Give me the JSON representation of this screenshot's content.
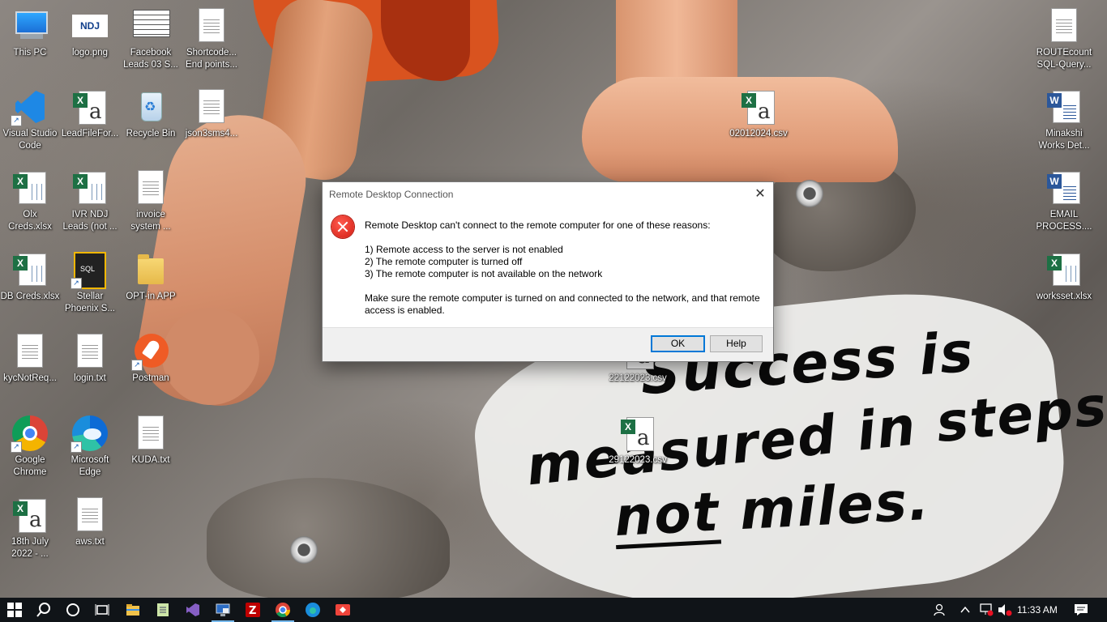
{
  "desktop": {
    "icons": [
      {
        "label": "This PC",
        "type": "pc"
      },
      {
        "label": "logo.png",
        "type": "ndj"
      },
      {
        "label": "Facebook Leads 03 S...",
        "type": "xls-sheet"
      },
      {
        "label": "Shortcode... End points...",
        "type": "doc"
      },
      {
        "label": "ROUTEcount SQL-Query...",
        "type": "doc"
      },
      {
        "label": "Visual Studio Code",
        "type": "vscode"
      },
      {
        "label": "LeadFileFor...",
        "type": "csv"
      },
      {
        "label": "Recycle Bin",
        "type": "bin"
      },
      {
        "label": "json3sms4...",
        "type": "doc"
      },
      {
        "label": "02012024.csv",
        "type": "csv"
      },
      {
        "label": "Minakshi Works Det...",
        "type": "word"
      },
      {
        "label": "Olx Creds.xlsx",
        "type": "xls"
      },
      {
        "label": "IVR NDJ Leads (not ...",
        "type": "xls"
      },
      {
        "label": "invoice system ...",
        "type": "doc"
      },
      {
        "label": "EMAIL PROCESS....",
        "type": "word"
      },
      {
        "label": "DB Creds.xlsx",
        "type": "xls"
      },
      {
        "label": "Stellar Phoenix S...",
        "type": "stellar"
      },
      {
        "label": "OPT-in APP",
        "type": "folder"
      },
      {
        "label": "worksset.xlsx",
        "type": "xls"
      },
      {
        "label": "kycNotReq...",
        "type": "doc"
      },
      {
        "label": "login.txt",
        "type": "doc"
      },
      {
        "label": "Postman",
        "type": "postman"
      },
      {
        "label": "22122023.csv",
        "type": "csv"
      },
      {
        "label": "Google Chrome",
        "type": "chrome"
      },
      {
        "label": "Microsoft Edge",
        "type": "edge"
      },
      {
        "label": "KUDA.txt",
        "type": "doc"
      },
      {
        "label": "29122023.csv",
        "type": "csv"
      },
      {
        "label": "18th July 2022 - ...",
        "type": "csv"
      },
      {
        "label": "aws.txt",
        "type": "doc"
      }
    ]
  },
  "wallpaper": {
    "quote_line1": "Success is",
    "quote_line2": "measured in steps",
    "quote_line3_underlined": "not",
    "quote_line3_rest": " miles."
  },
  "dialog": {
    "title": "Remote Desktop Connection",
    "close_glyph": "✕",
    "message": "Remote Desktop can't connect to the remote computer for one of these reasons:",
    "reasons": [
      "1) Remote access to the server is not enabled",
      "2) The remote computer is turned off",
      "3) The remote computer is not available on the network"
    ],
    "advice": "Make sure the remote computer is turned on and connected to the network, and that remote access is enabled.",
    "ok_label": "OK",
    "help_label": "Help"
  },
  "taskbar": {
    "pinned": [
      "start-icon",
      "search-icon",
      "cortana-icon",
      "task-view-icon",
      "file-explorer-icon",
      "notepad-icon",
      "visual-studio-icon",
      "remote-desktop-icon",
      "filezilla-icon",
      "chrome-icon",
      "edge-icon",
      "anydesk-icon"
    ],
    "clock": "11:33 AM",
    "accent": "#76b9ed"
  },
  "colors": {
    "error_red": "#d21d12",
    "ok_border": "#0078d7",
    "taskbar_bg": "#101418"
  }
}
